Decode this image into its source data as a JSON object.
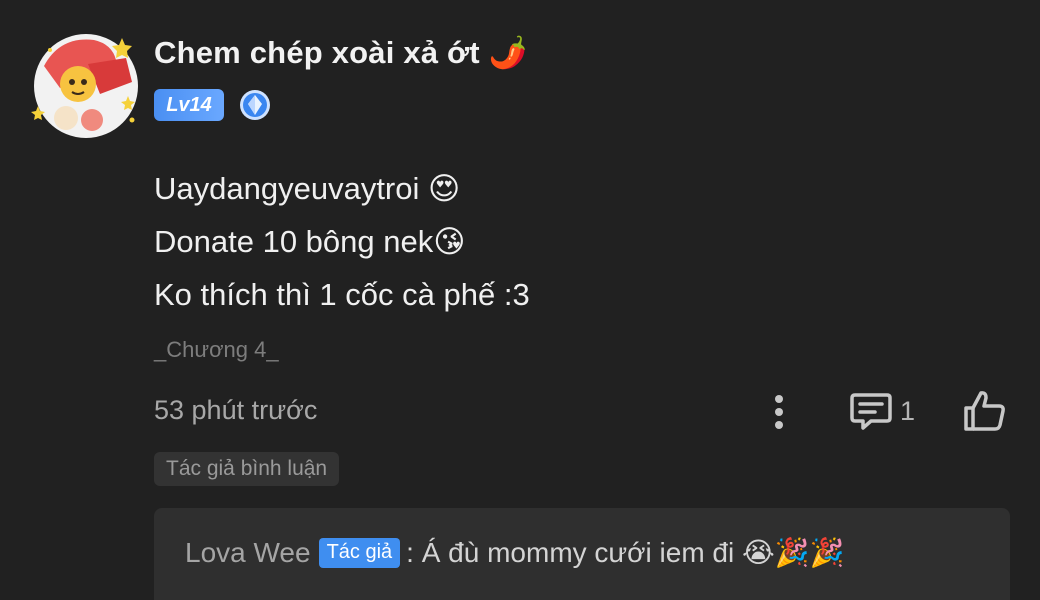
{
  "comment": {
    "username": "Chem chép xoài xả ớt 🌶️",
    "level_badge": "Lv14",
    "lines": [
      "Uaydangyeuvaytroi 😍",
      "Donate 10 bông nek😘",
      "Ko thích thì 1 cốc cà phế :3"
    ],
    "chapter": "_Chương 4_",
    "time_ago": "53 phút trước",
    "reply_count": "1",
    "tag": "Tác giả bình luận"
  },
  "reply": {
    "author": "Lova Wee",
    "author_badge": "Tác giả",
    "text": ": Á đù mommy cưới iem đi 😭🎉🎉"
  },
  "colors": {
    "background": "#212121",
    "badge_blue": "#3f8ef0",
    "reply_box": "#2f2f2f"
  },
  "icons": [
    "vip-diamond-icon",
    "more-vertical-icon",
    "reply-comment-icon",
    "thumbs-up-icon"
  ]
}
